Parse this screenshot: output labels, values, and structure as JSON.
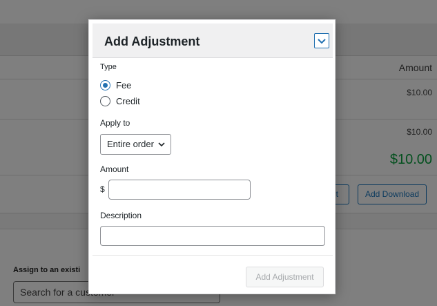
{
  "background": {
    "amount_header": "Amount",
    "row_amounts": [
      "$10.00",
      "$10.00"
    ],
    "total": "$10.00",
    "buttons": [
      "nt",
      "Add Download"
    ],
    "assign_label": "Assign to an existi",
    "search_placeholder": "Search for a customer"
  },
  "modal": {
    "title": "Add Adjustment",
    "type_label": "Type",
    "type_options": [
      {
        "label": "Fee",
        "checked": true
      },
      {
        "label": "Credit",
        "checked": false
      }
    ],
    "apply_label": "Apply to",
    "apply_value": "Entire order",
    "amount_label": "Amount",
    "currency_symbol": "$",
    "amount_value": "",
    "description_label": "Description",
    "description_value": "",
    "submit_label": "Add Adjustment"
  },
  "colors": {
    "accent": "#2271b1",
    "overlay": "#7f7f7f",
    "total_green": "#03501e"
  }
}
